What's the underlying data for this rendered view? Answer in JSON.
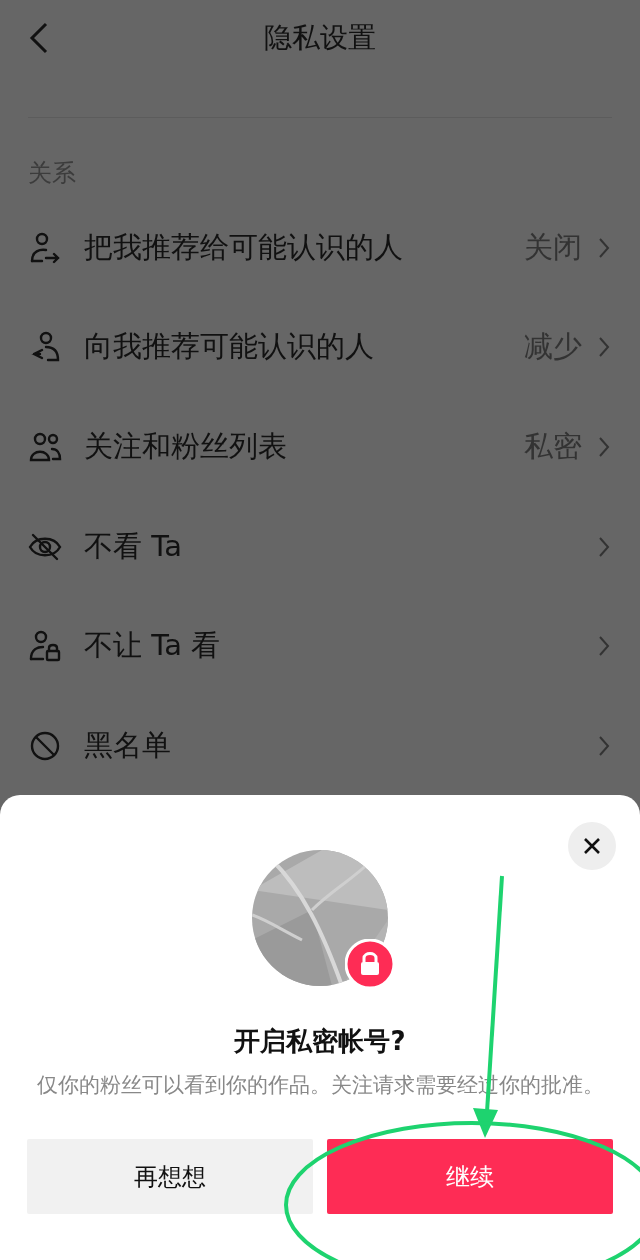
{
  "header": {
    "title": "隐私设置"
  },
  "section": {
    "label": "关系"
  },
  "rows": [
    {
      "label": "把我推荐给可能认识的人",
      "value": "关闭"
    },
    {
      "label": "向我推荐可能认识的人",
      "value": "减少"
    },
    {
      "label": "关注和粉丝列表",
      "value": "私密"
    },
    {
      "label": "不看 Ta"
    },
    {
      "label": "不让 Ta 看"
    },
    {
      "label": "黑名单"
    }
  ],
  "dialog": {
    "title": "开启私密帐号?",
    "description": "仅你的粉丝可以看到你的作品。关注请求需要经过你的批准。",
    "buttons": [
      {
        "label": "再想想",
        "kind": "secondary"
      },
      {
        "label": "继续",
        "kind": "primary"
      }
    ]
  }
}
